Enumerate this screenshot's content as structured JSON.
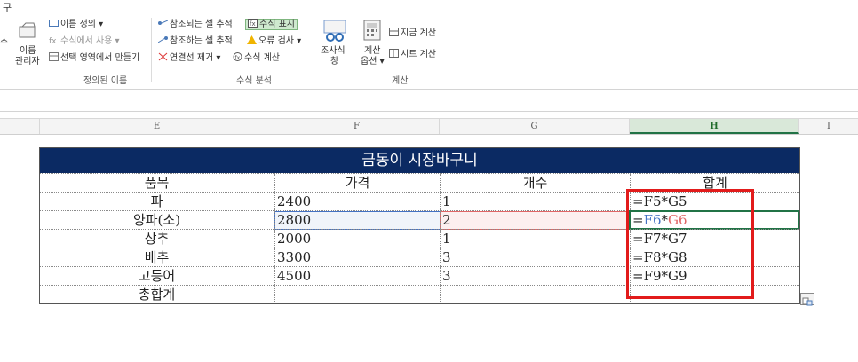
{
  "ribbon": {
    "tab_fragment": "구",
    "defined_names": {
      "name_manager_fragment": "수",
      "name_manager_label_1": "이름",
      "name_manager_label_2": "관리자",
      "define_name": "이름 정의 ▾",
      "use_in_formula": "수식에서 사용 ▾",
      "create_from_selection": "선택 영역에서 만들기",
      "group_label": "정의된 이름"
    },
    "formula_auditing": {
      "trace_precedents": "참조되는 셀 추적",
      "trace_dependents": "참조하는 셀 추적",
      "remove_arrows": "연결선 제거 ▾",
      "show_formulas": "수식 표시",
      "error_checking": "오류 검사 ▾",
      "evaluate_formula": "수식 계산",
      "watch_window_1": "조사식",
      "watch_window_2": "창",
      "group_label": "수식 분석"
    },
    "calculation": {
      "options_1": "계산",
      "options_2": "옵션 ▾",
      "calc_now": "지금 계산",
      "calc_sheet": "시트 계산",
      "group_label": "계산"
    }
  },
  "columns": [
    "E",
    "F",
    "G",
    "H",
    "I"
  ],
  "selected_column": "H",
  "table": {
    "title": "금동이 시장바구니",
    "headers": [
      "품목",
      "가격",
      "개수",
      "합계"
    ],
    "rows": [
      {
        "item": "파",
        "price": "2400",
        "qty": "1",
        "total": "=F5*G5"
      },
      {
        "item": "양파(소)",
        "price": "2800",
        "qty": "2",
        "total_prefix": "=",
        "total_ref1": "F6",
        "total_op": "*",
        "total_ref2": "G6"
      },
      {
        "item": "상추",
        "price": "2000",
        "qty": "1",
        "total": "=F7*G7"
      },
      {
        "item": "배추",
        "price": "3300",
        "qty": "3",
        "total": "=F8*G8"
      },
      {
        "item": "고등어",
        "price": "4500",
        "qty": "3",
        "total": "=F9*G9"
      }
    ],
    "footer": {
      "item": "총합계",
      "price": "",
      "qty": "",
      "total": ""
    }
  },
  "colors": {
    "title_bg": "#0b2a63",
    "ref_blue": "#4472c4",
    "ref_red": "#e06666",
    "highlight_box": "#e21b1b",
    "active_cell": "#217346"
  }
}
